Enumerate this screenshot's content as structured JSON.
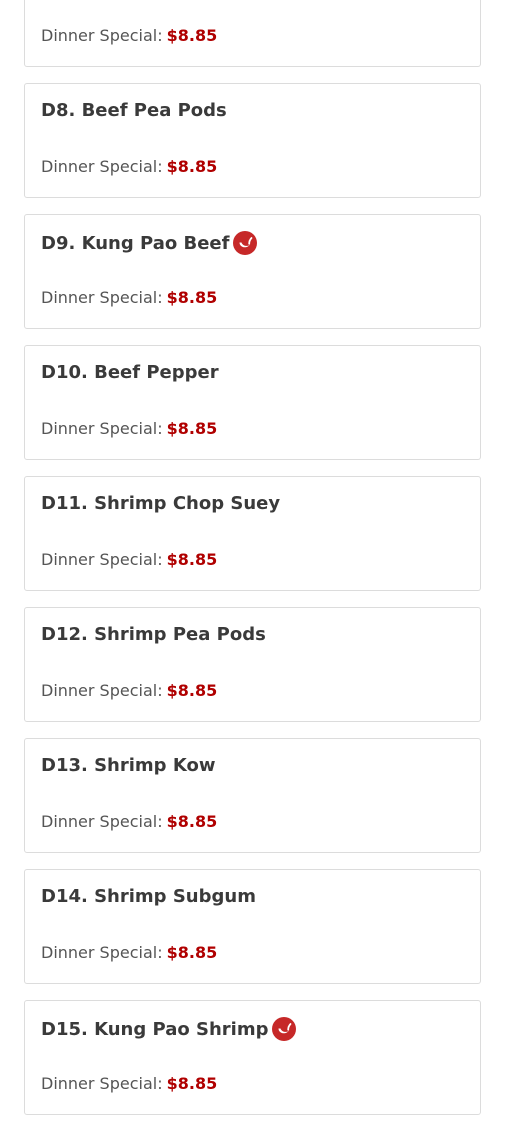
{
  "colors": {
    "title": "#3a3a3a",
    "label": "#555555",
    "price": "#b00000",
    "spicy_icon": "#c62828",
    "card_border": "#dcdcdc"
  },
  "items": [
    {
      "name": "",
      "label": "Dinner Special:",
      "price": "$8.85",
      "spicy": false
    },
    {
      "name": "D8. Beef Pea Pods",
      "label": "Dinner Special:",
      "price": "$8.85",
      "spicy": false
    },
    {
      "name": "D9. Kung Pao Beef",
      "label": "Dinner Special:",
      "price": "$8.85",
      "spicy": true,
      "icon": "spicy-pepper-icon"
    },
    {
      "name": "D10. Beef Pepper",
      "label": "Dinner Special:",
      "price": "$8.85",
      "spicy": false
    },
    {
      "name": "D11. Shrimp Chop Suey",
      "label": "Dinner Special:",
      "price": "$8.85",
      "spicy": false
    },
    {
      "name": "D12. Shrimp Pea Pods",
      "label": "Dinner Special:",
      "price": "$8.85",
      "spicy": false
    },
    {
      "name": "D13. Shrimp Kow",
      "label": "Dinner Special:",
      "price": "$8.85",
      "spicy": false
    },
    {
      "name": "D14. Shrimp Subgum",
      "label": "Dinner Special:",
      "price": "$8.85",
      "spicy": false
    },
    {
      "name": "D15. Kung Pao Shrimp",
      "label": "Dinner Special:",
      "price": "$8.85",
      "spicy": true,
      "icon": "spicy-pepper-icon"
    }
  ]
}
